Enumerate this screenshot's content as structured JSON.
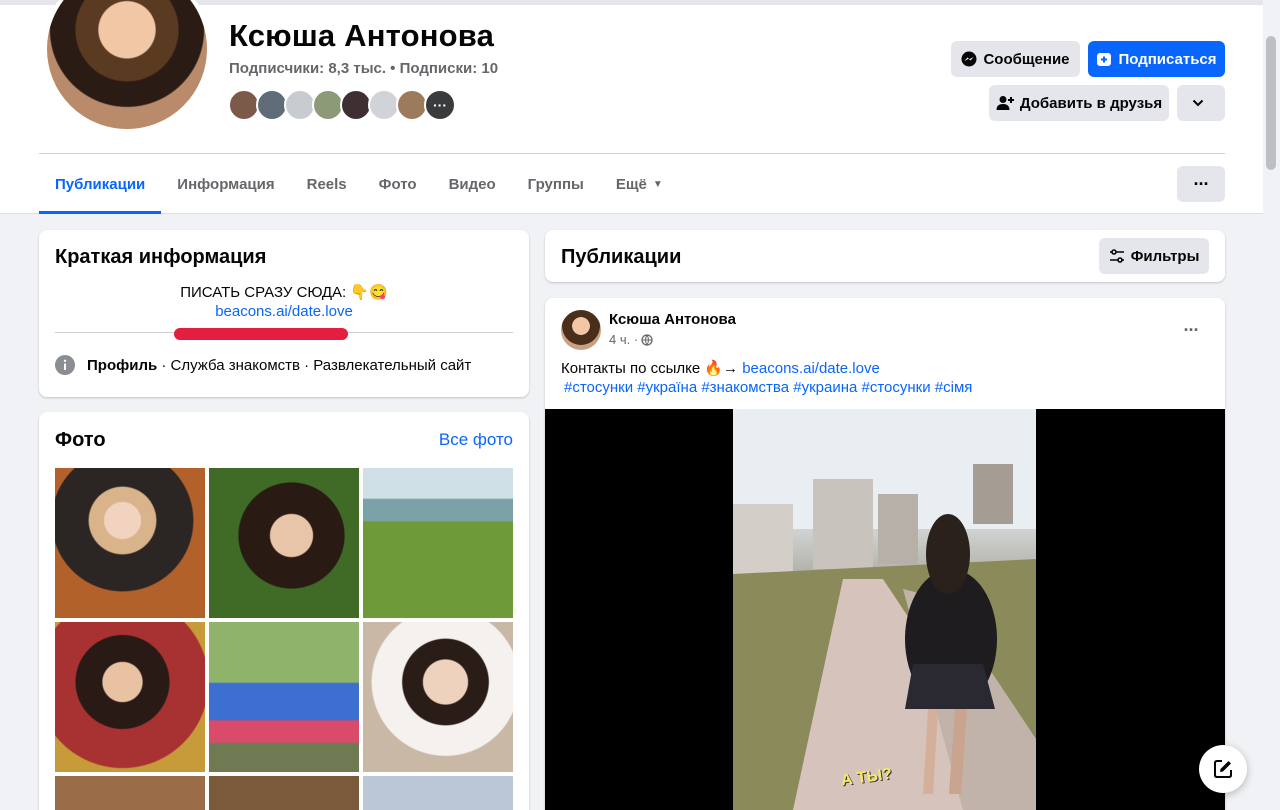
{
  "profile": {
    "name": "Ксюша Антонова",
    "followers": "Подписчики: 8,3 тыс. • Подписки: 10",
    "friend_avatar_colors": [
      "#7b5a4a",
      "#5f6b76",
      "#c8ccd0",
      "#8c9a78",
      "#3f2f33",
      "#d0d3d7",
      "#9c7a5c",
      "#3a3b3c"
    ]
  },
  "actions": {
    "message": "Сообщение",
    "subscribe": "Подписаться",
    "add_friend": "Добавить в друзья"
  },
  "tabs": [
    {
      "label": "Публикации",
      "active": true
    },
    {
      "label": "Информация"
    },
    {
      "label": "Reels"
    },
    {
      "label": "Фото"
    },
    {
      "label": "Видео"
    },
    {
      "label": "Группы"
    },
    {
      "label": "Ещё"
    }
  ],
  "intro": {
    "title": "Краткая информация",
    "bio_line1": "ПИСАТЬ СРАЗУ СЮДА: 👇😋",
    "bio_link": "beacons.ai/date.love",
    "profile_bold": "Профиль",
    "profile_rest": " · Служба знакомств · Развлекательный сайт"
  },
  "photos": {
    "title": "Фото",
    "see_all": "Все фото"
  },
  "posts_header": {
    "title": "Публикации",
    "filters": "Фильтры"
  },
  "post": {
    "author": "Ксюша Антонова",
    "time": "4 ч. ·",
    "text_prefix": "Контакты по ссылке 🔥→ ",
    "link": "beacons.ai/date.love",
    "hashtags": "#стосунки #україна #знакомства #украина #стосунки #сімя",
    "video_caption": "А ТЫ?"
  },
  "colors": {
    "accent": "#0866ff",
    "background": "#f0f2f5",
    "muted_text": "#65676b"
  }
}
